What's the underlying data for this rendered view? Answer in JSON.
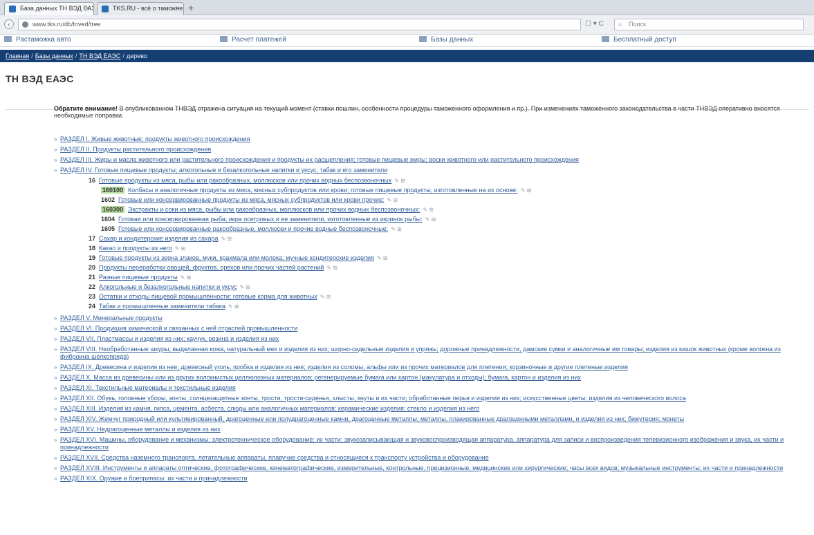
{
  "browser": {
    "tabs": [
      {
        "label": "База данных ТН ВЭД ЕАЭС...",
        "active": true
      },
      {
        "label": "TKS.RU - всё о таможне: Б...",
        "active": false
      }
    ],
    "new_tab": "+",
    "url": "www.tks.ru/db/tnved/tree",
    "url_tools": "☐ ▾ C",
    "search_placeholder": "Поиск"
  },
  "site_menu": [
    "Растаможка авто",
    "Расчет платежей",
    "Базы данных",
    "Бесплатный доступ"
  ],
  "breadcrumb": {
    "items": [
      "Главная",
      "Базы данных",
      "ТН ВЭД ЕАЭС"
    ],
    "current": "дерево",
    "separator": "/"
  },
  "page_title": "ТН ВЭД ЕАЭС",
  "notice": {
    "lead": "Обратите внимание!",
    "text": "В опубликованном ТНВЭД отражена ситуация на текущий момент (ставки пошлин, особенности процедуры таможенного оформления и пр.). При изменениях таможенного законодательства в части ТНВЭД оперативно вносятся необходимые поправки."
  },
  "sections_before": [
    "РАЗДЕЛ I. Живые животные; продукты животного происхождения",
    "РАЗДЕЛ II. Продукты растительного происхождения",
    "РАЗДЕЛ III. Жиры и масла животного или растительного происхождения и продукты их расщепления; готовые пищевые жиры; воски животного или растительного происхождения",
    "РАЗДЕЛ IV. Готовые пищевые продукты; алкогольные и безалкогольные напитки и уксус; табак и его заменители"
  ],
  "group_16": {
    "code": "16",
    "label": "Готовые продукты из мяса, рыбы или ракообразных, моллюсков или прочих водных беспозвоночных",
    "tools": "✎ ⊞"
  },
  "positions": [
    {
      "code": "160100",
      "label": "Колбасы и аналогичные продукты из мяса, мясных субпродуктов или крови; готовые пищевые продукты, изготовленные на их основе:",
      "tools": "✎ ⊞"
    },
    {
      "code": "1602",
      "label": "Готовые или консервированные продукты из мяса, мясных субпродуктов или крови прочие:",
      "tools": "✎ ⊞"
    },
    {
      "code": "160300",
      "label": "Экстракты и соки из мяса, рыбы или ракообразных, моллюсков или прочих водных беспозвоночных:",
      "tools": "✎ ⊞"
    },
    {
      "code": "1604",
      "label": "Готовая или консервированная рыба; икра осетровых и ее заменители, изготовленные из икринок рыбы:",
      "tools": "✎ ⊞"
    },
    {
      "code": "1605",
      "label": "Готовые или консервированные ракообразные, моллюски и прочие водные беспозвоночные:",
      "tools": "✎ ⊞"
    }
  ],
  "groups": [
    {
      "code": "17",
      "label": "Сахар и кондитерские изделия из сахара",
      "tools": "✎ ⊞"
    },
    {
      "code": "18",
      "label": "Какао и продукты из него",
      "tools": "✎ ⊞"
    },
    {
      "code": "19",
      "label": "Готовые продукты из зерна злаков, муки, крахмала или молока; мучные кондитерские изделия",
      "tools": "✎ ⊞"
    },
    {
      "code": "20",
      "label": "Продукты переработки овощей, фруктов, орехов или прочих частей растений",
      "tools": "✎ ⊞"
    },
    {
      "code": "21",
      "label": "Разные пищевые продукты",
      "tools": "✎ ⊞"
    },
    {
      "code": "22",
      "label": "Алкогольные и безалкогольные напитки и уксус",
      "tools": "✎ ⊞"
    },
    {
      "code": "23",
      "label": "Остатки и отходы пищевой промышленности; готовые корма для животных",
      "tools": "✎ ⊞"
    },
    {
      "code": "24",
      "label": "Табак и промышленные заменители табака",
      "tools": "✎ ⊞"
    }
  ],
  "sections_after": [
    "РАЗДЕЛ V. Минеральные продукты",
    "РАЗДЕЛ VI. Продукция химической и связанных с ней отраслей промышленности",
    "РАЗДЕЛ VII. Пластмассы и изделия из них; каучук, резина и изделия из них",
    "РАЗДЕЛ VIII. Необработанные шкуры, выделанная кожа, натуральный мех и изделия из них; шорно-седельные изделия и упряжь; дорожные принадлежности, дамские сумки и аналогичные им товары; изделия из кишок животных (кроме волокна из фиброина шелкопряда)",
    "РАЗДЕЛ IX. Древесина и изделия из нее; древесный уголь; пробка и изделия из нее; изделия из соломы, альфы или из прочих материалов для плетения; корзиночные и другие плетеные изделия",
    "РАЗДЕЛ X. Масса из древесины или из других волокнистых целлюлозных материалов; регенерируемые бумага или картон (макулатура и отходы); бумага, картон и изделия из них",
    "РАЗДЕЛ XI. Текстильные материалы и текстильные изделия",
    "РАЗДЕЛ XII. Обувь, головные уборы, зонты, солнцезащитные зонты, трости, трости-сиденья, хлысты, кнуты и их части; обработанные перья и изделия из них; искусственные цветы; изделия из человеческого волоса",
    "РАЗДЕЛ XIII. Изделия из камня, гипса, цемента, асбеста, слюды или аналогичных материалов; керамические изделия; стекло и изделия из него",
    "РАЗДЕЛ XIV. Жемчуг природный или культивированный, драгоценные или полудрагоценные камни, драгоценные металлы, металлы, плакированные драгоценными металлами, и изделия из них; бижутерия; монеты",
    "РАЗДЕЛ XV. Недрагоценные металлы и изделия из них",
    "РАЗДЕЛ XVI. Машины, оборудование и механизмы; электротехническое оборудование; их части; звукозаписывающая и звуковоспроизводящая аппаратура, аппаратура для записи и воспроизведения телевизионного изображения и звука, их части и принадлежности",
    "РАЗДЕЛ XVII. Средства наземного транспорта, летательные аппараты, плавучие средства и относящиеся к транспорту устройства и оборудование",
    "РАЗДЕЛ XVIII. Инструменты и аппараты оптические, фотографические, кинематографические, измерительные, контрольные, прецизионные, медицинские или хирургические; часы всех видов; музыкальные инструменты; их части и принадлежности",
    "РАЗДЕЛ XIX. Оружие и боеприпасы; их части и принадлежности"
  ]
}
